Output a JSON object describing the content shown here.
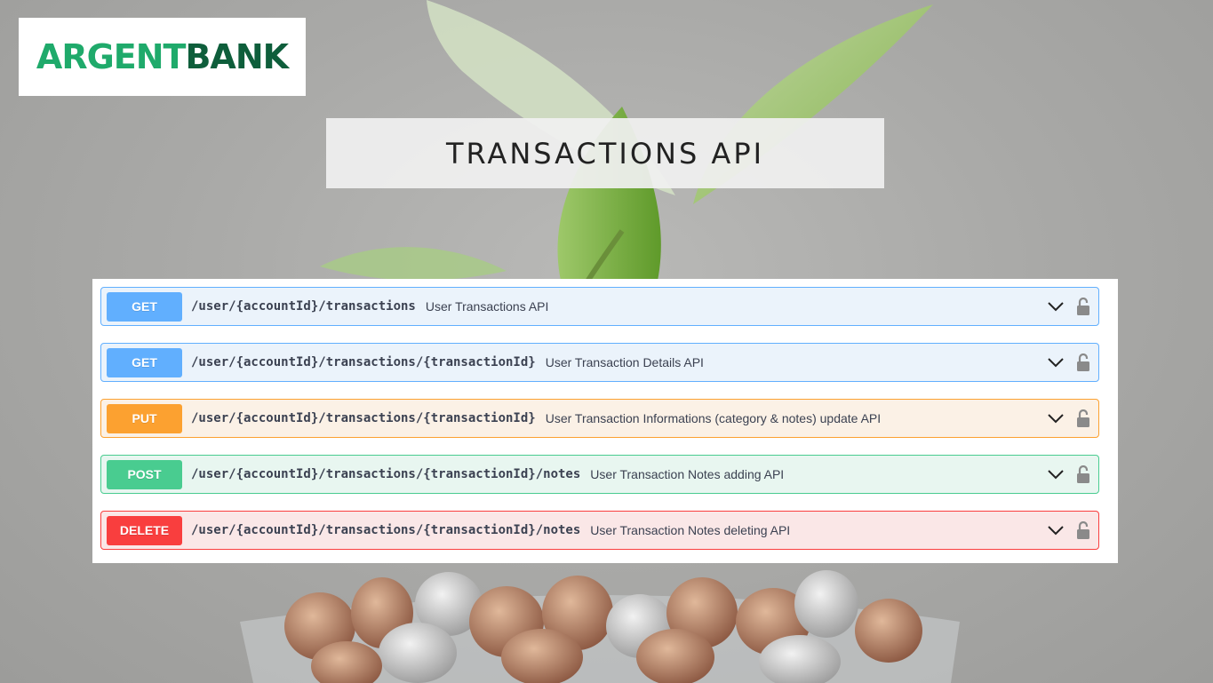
{
  "brand": {
    "name_part1": "ARGENT",
    "name_part2": "BANK",
    "color_part1": "#1faa6b",
    "color_part2": "#0e5e3b"
  },
  "header": {
    "title": "TRANSACTIONS API"
  },
  "operations": [
    {
      "method": "GET",
      "path": "/user/{accountId}/transactions",
      "summary": "User Transactions API",
      "color": "#61affe",
      "expand_icon": "chevron-down-icon",
      "auth_icon": "lock-open-icon"
    },
    {
      "method": "GET",
      "path": "/user/{accountId}/transactions/{transactionId}",
      "summary": "User Transaction Details API",
      "color": "#61affe",
      "expand_icon": "chevron-down-icon",
      "auth_icon": "lock-open-icon"
    },
    {
      "method": "PUT",
      "path": "/user/{accountId}/transactions/{transactionId}",
      "summary": "User Transaction Informations (category & notes) update API",
      "color": "#fca130",
      "expand_icon": "chevron-down-icon",
      "auth_icon": "lock-open-icon"
    },
    {
      "method": "POST",
      "path": "/user/{accountId}/transactions/{transactionId}/notes",
      "summary": "User Transaction Notes adding API",
      "color": "#49cc90",
      "expand_icon": "chevron-down-icon",
      "auth_icon": "lock-open-icon"
    },
    {
      "method": "DELETE",
      "path": "/user/{accountId}/transactions/{transactionId}/notes",
      "summary": "User Transaction Notes deleting API",
      "color": "#f93e3e",
      "expand_icon": "chevron-down-icon",
      "auth_icon": "lock-open-icon"
    }
  ]
}
